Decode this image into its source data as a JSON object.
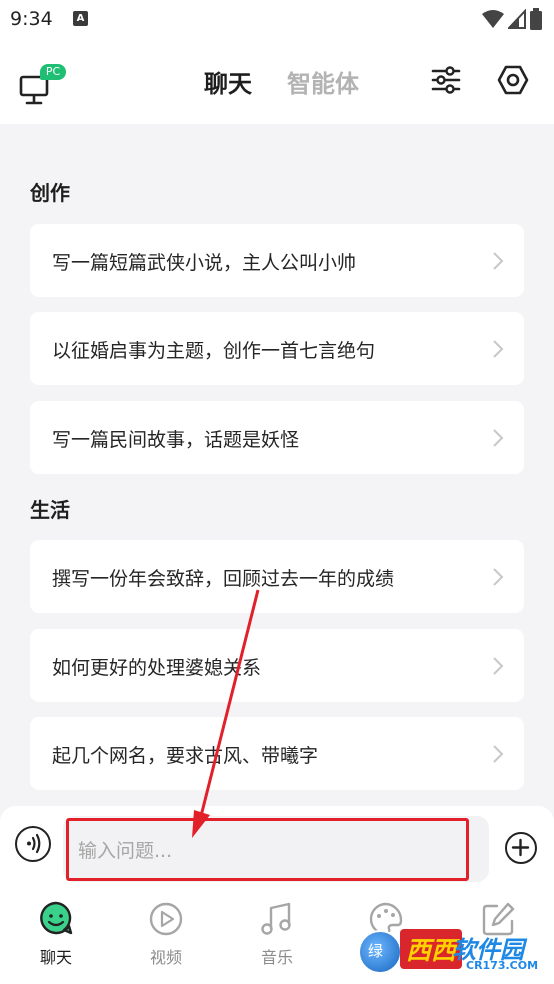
{
  "status_bar": {
    "time": "9:34",
    "notification_badge": "A"
  },
  "header": {
    "device_badge": "PC",
    "tabs": [
      {
        "label": "聊天",
        "active": true
      },
      {
        "label": "智能体",
        "active": false
      }
    ],
    "icons": {
      "device": "monitor-icon",
      "filter": "sliders-icon",
      "settings": "gear-icon"
    }
  },
  "sections": [
    {
      "title": "创作",
      "prompts": [
        "写一篇短篇武侠小说，主人公叫小帅",
        "以征婚启事为主题，创作一首七言绝句",
        "写一篇民间故事，话题是妖怪"
      ]
    },
    {
      "title": "生活",
      "prompts": [
        "撰写一份年会致辞，回顾过去一年的成绩",
        "如何更好的处理婆媳关系",
        "起几个网名，要求古风、带曦字"
      ]
    }
  ],
  "composer": {
    "placeholder": "输入问题...",
    "value": ""
  },
  "bottom_nav": [
    {
      "label": "聊天",
      "icon": "smile-chat-icon",
      "active": true
    },
    {
      "label": "视频",
      "icon": "play-circle-icon",
      "active": false
    },
    {
      "label": "音乐",
      "icon": "music-note-icon",
      "active": false
    },
    {
      "label": "",
      "icon": "palette-icon",
      "active": false
    },
    {
      "label": "",
      "icon": "edit-icon",
      "active": false
    }
  ],
  "watermark": {
    "small": "绿",
    "name": "西西",
    "rest": "软件园",
    "domain": "CR173.COM"
  },
  "colors": {
    "accent_green": "#1fbf73",
    "highlight_red": "#e2202a",
    "background": "#f4f4f6",
    "inactive": "#b3b3b3"
  }
}
